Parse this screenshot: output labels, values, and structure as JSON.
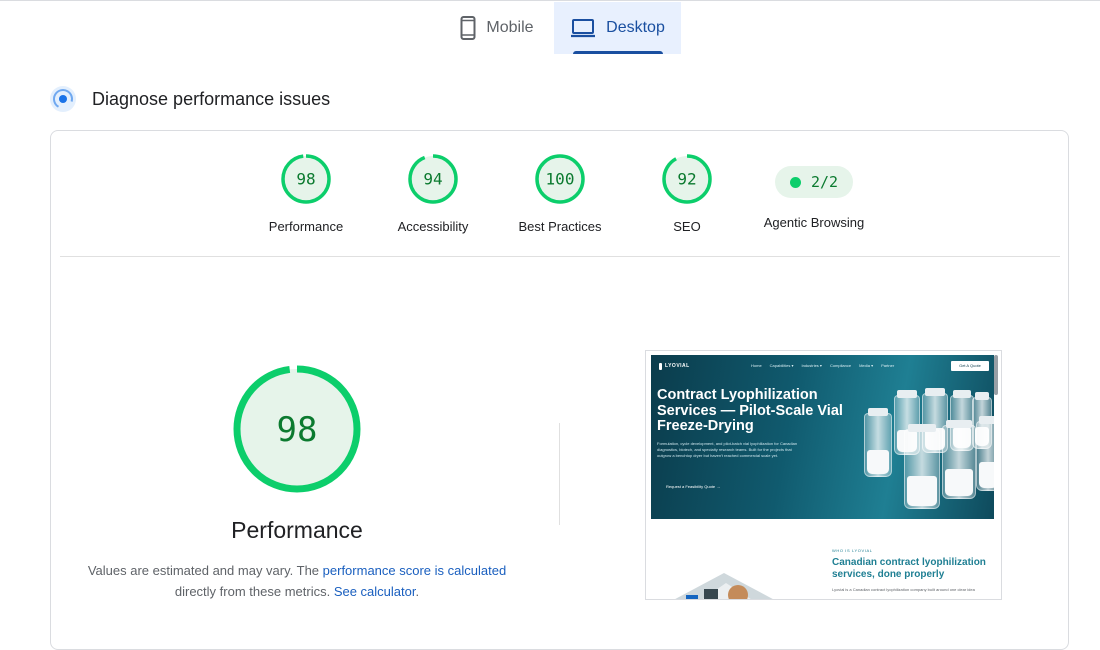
{
  "tabs": [
    {
      "label": "Mobile",
      "icon": "smartphone-icon",
      "selected": false
    },
    {
      "label": "Desktop",
      "icon": "laptop-icon",
      "selected": true
    }
  ],
  "section": {
    "title": "Diagnose performance issues",
    "icon": "diagnose-icon"
  },
  "scores": [
    {
      "label": "Performance",
      "score": "98"
    },
    {
      "label": "Accessibility",
      "score": "94"
    },
    {
      "label": "Best Practices",
      "score": "100"
    },
    {
      "label": "SEO",
      "score": "92"
    }
  ],
  "agentic": {
    "label": "Agentic Browsing",
    "value": "2/2"
  },
  "main_gauge": {
    "score": "98",
    "label": "Performance"
  },
  "description": {
    "text1": "Values are estimated and may vary. The ",
    "link1": "performance score is calculated",
    "text2": "directly from these metrics. ",
    "link2": "See calculator",
    "text3": "."
  },
  "screenshot": {
    "logo": "LYOVIAL",
    "nav": [
      "Home",
      "Capabilities ▾",
      "Industries ▾",
      "Compliance",
      "Media ▾",
      "Partner"
    ],
    "cta": "Get A Quote",
    "hero_title": "Contract Lyophilization Services — Pilot-Scale Vial Freeze-Drying",
    "hero_body": "Formulation, cycle development, and pilot-batch vial lyophilization for Canadian diagnostics, biotech, and specialty research teams. Built for the projects that outgrow a benchtop dryer but haven't reached commercial scale yet.",
    "hero_link": "Request a Feasibility Quote →",
    "kicker": "WHO IS LYOVIAL",
    "section_title": "Canadian contract lyophilization services, done properly",
    "section_body": "Lyovial is a Canadian contract lyophilization company built around one clear idea"
  },
  "colors": {
    "pass": "#0cce6b",
    "pass_text": "#0b7a2f",
    "pass_bg": "#e6f4ea",
    "accent": "#1a4fa0"
  }
}
